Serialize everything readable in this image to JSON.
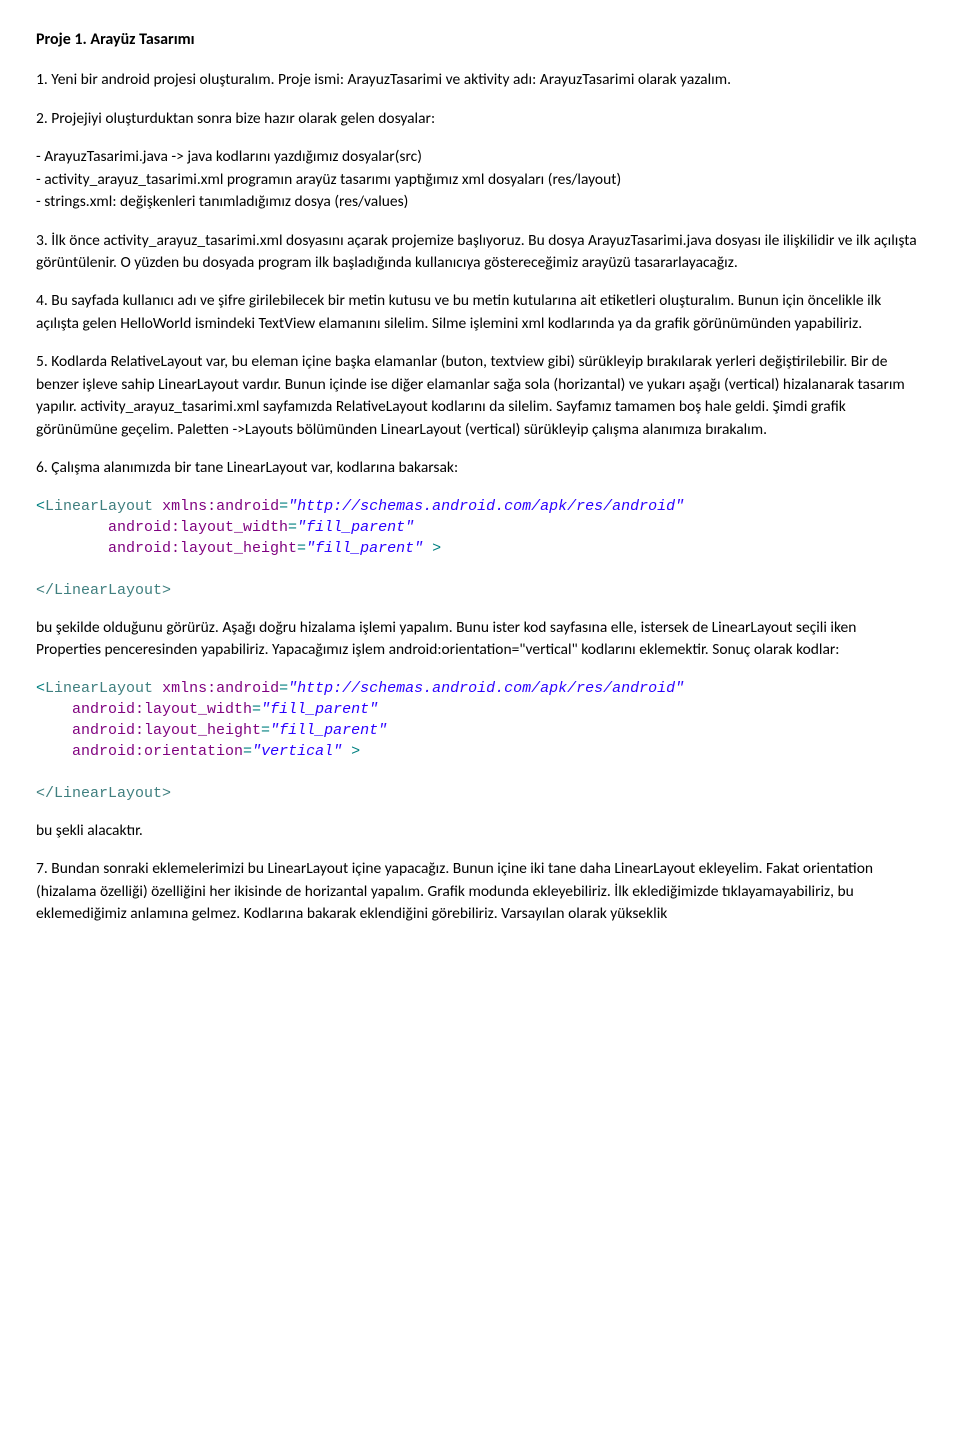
{
  "title": "Proje 1. Arayüz Tasarımı",
  "p1": "1. Yeni bir android projesi oluşturalım. Proje ismi: ArayuzTasarimi ve aktivity adı: ArayuzTasarimi olarak yazalım.",
  "p2": "2. Projejiyi oluşturduktan sonra bize hazır olarak gelen dosyalar:",
  "p3a": "- ArayuzTasarimi.java -> java kodlarını yazdığımız dosyalar(src)",
  "p3b": "- activity_arayuz_tasarimi.xml  programın arayüz tasarımı yaptığımız xml dosyaları (res/layout)",
  "p3c": "- strings.xml: değişkenleri tanımladığımız dosya (res/values)",
  "p4": "3. İlk önce activity_arayuz_tasarimi.xml dosyasını açarak projemize başlıyoruz. Bu dosya ArayuzTasarimi.java dosyası ile ilişkilidir ve ilk açılışta görüntülenir. O yüzden bu dosyada program ilk başladığında kullanıcıya göstereceğimiz arayüzü tasararlayacağız.",
  "p5": "4. Bu sayfada kullanıcı adı ve şifre girilebilecek bir metin kutusu ve bu metin kutularına ait etiketleri oluşturalım. Bunun için öncelikle ilk açılışta gelen HelloWorld ismindeki TextView elamanını silelim. Silme işlemini xml kodlarında ya da grafik görünümünden yapabiliriz.",
  "p6": "5. Kodlarda RelativeLayout var, bu eleman içine başka elamanlar (buton, textview gibi) sürükleyip bırakılarak yerleri değiştirilebilir. Bir de benzer işleve sahip LinearLayout vardır. Bunun içinde ise diğer elamanlar sağa sola (horizantal) ve yukarı aşağı (vertical) hizalanarak tasarım yapılır. activity_arayuz_tasarimi.xml sayfamızda RelativeLayout kodlarını da silelim. Sayfamız tamamen boş hale geldi. Şimdi grafik görünümüne geçelim. Paletten ->Layouts bölümünden LinearLayout (vertical) sürükleyip çalışma alanımıza bırakalım.",
  "p7": "6. Çalışma alanımızda bir tane LinearLayout var, kodlarına bakarsak:",
  "code1": {
    "tag": "LinearLayout",
    "ns_attr": "xmlns:android",
    "ns_val": "\"http://schemas.android.com/apk/res/android\"",
    "w_attr": "android:layout_width",
    "w_val": "\"fill_parent\"",
    "h_attr": "android:layout_height",
    "h_val": "\"fill_parent\"",
    "close": "</LinearLayout>"
  },
  "p8": "bu şekilde olduğunu görürüz. Aşağı doğru hizalama işlemi yapalım. Bunu ister kod sayfasına elle, istersek de LinearLayout seçili iken Properties penceresinden yapabiliriz. Yapacağımız işlem android:orientation=\"vertical\" kodlarını eklemektir. Sonuç olarak kodlar:",
  "code2": {
    "tag": "LinearLayout",
    "ns_attr": "xmlns:android",
    "ns_val": "\"http://schemas.android.com/apk/res/android\"",
    "w_attr": "android:layout_width",
    "w_val": "\"fill_parent\"",
    "h_attr": "android:layout_height",
    "h_val": "\"fill_parent\"",
    "o_attr": "android:orientation",
    "o_val": "\"vertical\"",
    "close": "</LinearLayout>"
  },
  "p9": "bu şekli alacaktır.",
  "p10": "7. Bundan sonraki eklemelerimizi bu LinearLayout içine yapacağız. Bunun içine iki tane daha LinearLayout ekleyelim. Fakat orientation (hizalama özelliği) özelliğini her ikisinde de horizantal yapalım. Grafik modunda ekleyebiliriz. İlk eklediğimizde tıklayamayabiliriz, bu eklemediğimiz anlamına gelmez. Kodlarına bakarak eklendiğini görebiliriz. Varsayılan olarak yükseklik"
}
